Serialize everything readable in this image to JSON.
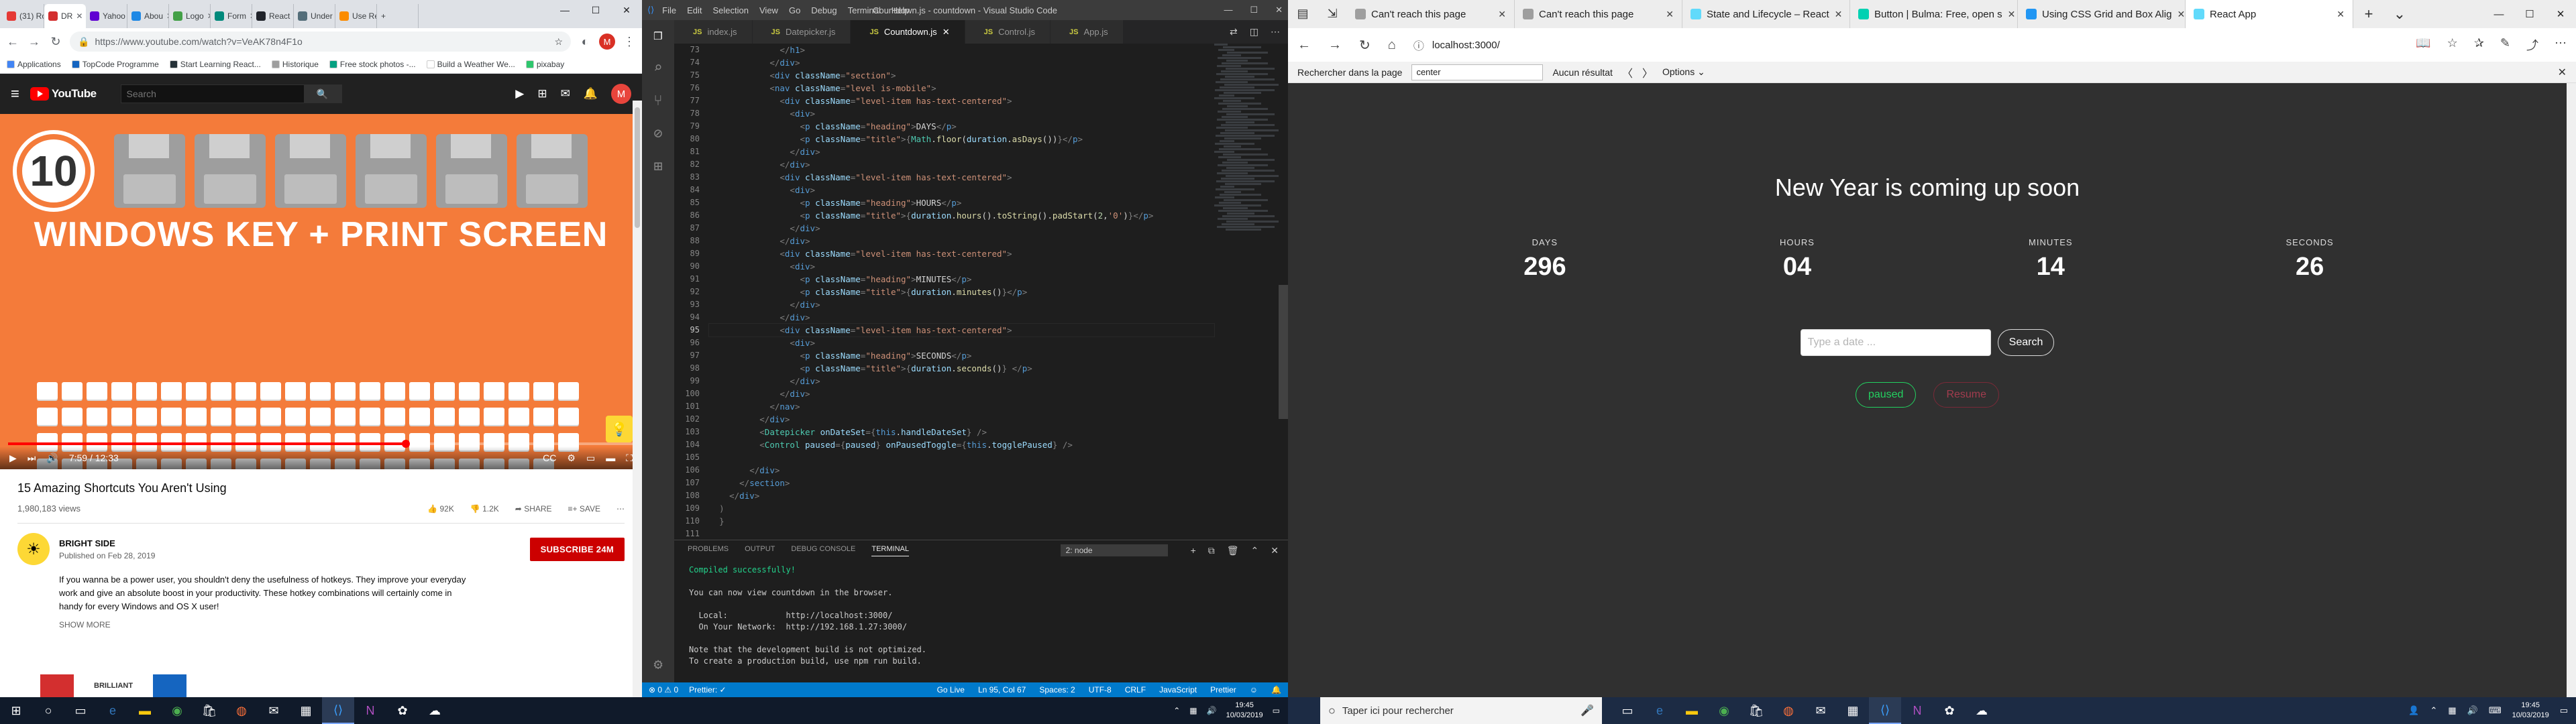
{
  "chrome": {
    "tabs": [
      {
        "label": "(31) Ro",
        "color": "#e53935"
      },
      {
        "label": "DR",
        "color": "#d32f2f"
      },
      {
        "label": "Yahoo",
        "color": "#6001d2"
      },
      {
        "label": "Abou",
        "color": "#1e88e5"
      },
      {
        "label": "Logo",
        "color": "#43a047"
      },
      {
        "label": "Form",
        "color": "#00897b"
      },
      {
        "label": "React",
        "color": "#20232a"
      },
      {
        "label": "Under",
        "color": "#546e7a"
      },
      {
        "label": "Use Re",
        "color": "#fb8c00"
      }
    ],
    "url": "https://www.youtube.com/watch?v=VeAK78n4F1o",
    "profile": "M",
    "bookmarks": [
      {
        "label": "Applications",
        "color": "#4285f4"
      },
      {
        "label": "TopCode Programme",
        "color": "#1565c0"
      },
      {
        "label": "Start Learning React...",
        "color": "#263238"
      },
      {
        "label": "Historique",
        "color": "#9e9e9e"
      },
      {
        "label": "Free stock photos -...",
        "color": "#05a081"
      },
      {
        "label": "Build a Weather We...",
        "color": "#ffffff"
      },
      {
        "label": "pixabay",
        "color": "#2ec66d"
      }
    ]
  },
  "youtube": {
    "logo_text": "YouTube",
    "search_placeholder": "Search",
    "avatar": "M",
    "notif_count": "9+",
    "thumb": {
      "number": "10",
      "title": "WINDOWS KEY + PRINT SCREEN"
    },
    "player": {
      "time": "7:59 / 12:33",
      "progress": 0.636
    },
    "video_title": "15 Amazing Shortcuts You Aren't Using",
    "views": "1,980,183 views",
    "likes": "92K",
    "dislikes": "1.2K",
    "share": "SHARE",
    "save": "SAVE",
    "channel": "BRIGHT SIDE",
    "published": "Published on Feb 28, 2019",
    "subscribe": "SUBSCRIBE 24M",
    "description": "If you wanna be a power user, you shouldn't deny the usefulness of hotkeys. They improve your everyday work and give an absolute boost in your productivity. These hotkey combinations will certainly come in handy for every Windows and OS X user!",
    "show_more": "SHOW MORE",
    "brilliant": "BRILLIANT"
  },
  "vscode": {
    "menu": [
      "File",
      "Edit",
      "Selection",
      "View",
      "Go",
      "Debug",
      "Terminal",
      "Help"
    ],
    "window_title": "Countdown.js - countdown - Visual Studio Code",
    "tabs": [
      {
        "label": "index.js",
        "active": false
      },
      {
        "label": "Datepicker.js",
        "active": false
      },
      {
        "label": "Countdown.js",
        "active": true
      },
      {
        "label": "Control.js",
        "active": false
      },
      {
        "label": "App.js",
        "active": false
      }
    ],
    "first_line": 73,
    "current_line": 95,
    "panel_tabs": [
      "PROBLEMS",
      "OUTPUT",
      "DEBUG CONSOLE",
      "TERMINAL"
    ],
    "terminal_select": "2: node",
    "terminal_lines": [
      "Compiled successfully!",
      "",
      "You can now view countdown in the browser.",
      "",
      "  Local:            http://localhost:3000/",
      "  On Your Network:  http://192.168.1.27:3000/",
      "",
      "Note that the development build is not optimized.",
      "To create a production build, use npm run build.",
      ""
    ],
    "status_left": [
      "⊗ 0 ⚠ 0",
      "Prettier: ✓"
    ],
    "status_right": [
      "Go Live",
      "Ln 95, Col 67",
      "Spaces: 2",
      "UTF-8",
      "CRLF",
      "JavaScript",
      "Prettier",
      "☺",
      "🔔"
    ]
  },
  "edge": {
    "tabs": [
      {
        "label": "Can't reach this page",
        "color": "#9e9e9e"
      },
      {
        "label": "Can't reach this page",
        "color": "#9e9e9e"
      },
      {
        "label": "State and Lifecycle – React",
        "color": "#61dafb"
      },
      {
        "label": "Button | Bulma: Free, open s",
        "color": "#00d1b2"
      },
      {
        "label": "Using CSS Grid and Box Alig",
        "color": "#2196f3"
      },
      {
        "label": "React App",
        "color": "#61dafb"
      }
    ],
    "address": "localhost:3000/",
    "find_label": "Rechercher dans la page",
    "find_value": "center",
    "find_result": "Aucun résultat",
    "options": "Options"
  },
  "app": {
    "title": "New Year is coming up soon",
    "counters": [
      {
        "label": "DAYS",
        "value": "296"
      },
      {
        "label": "HOURS",
        "value": "04"
      },
      {
        "label": "MINUTES",
        "value": "14"
      },
      {
        "label": "SECONDS",
        "value": "26"
      }
    ],
    "date_placeholder": "Type a date ...",
    "search_label": "Search",
    "paused_label": "paused",
    "resume_label": "Resume"
  },
  "taskbar": {
    "clock_time": "19:45",
    "clock_date": "10/03/2019",
    "search_placeholder": "Taper ici pour rechercher"
  }
}
